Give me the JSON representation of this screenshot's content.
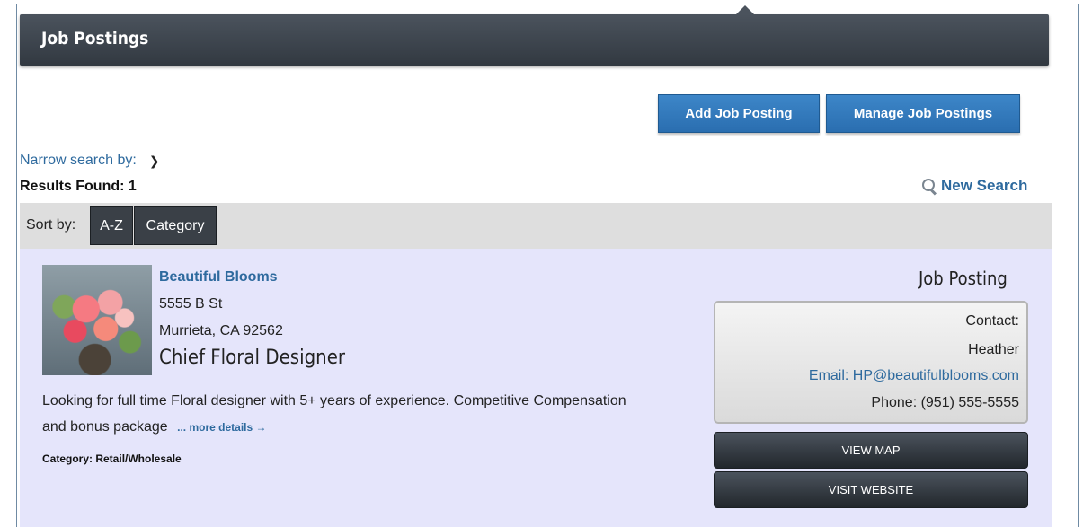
{
  "header": {
    "title": "Job Postings"
  },
  "toolbar": {
    "add_label": "Add Job Posting",
    "manage_label": "Manage Job Postings"
  },
  "filters": {
    "narrow_label": "Narrow search by:",
    "results_label": "Results Found: 1",
    "new_search_label": "New Search"
  },
  "sort": {
    "label": "Sort by:",
    "options": [
      "A-Z",
      "Category"
    ]
  },
  "listing": {
    "business_name": "Beautiful Blooms",
    "address_line1": "5555 B St",
    "address_line2": "Murrieta, CA 92562",
    "job_title": "Chief Floral Designer",
    "description": "Looking for full time Floral designer with 5+ years of experience. Competitive Compensation and bonus package",
    "more_label": "... more details →",
    "category": "Category: Retail/Wholesale",
    "type_label": "Job Posting",
    "contact_label": "Contact:",
    "contact_name": "Heather",
    "email": "Email: HP@beautifulblooms.com",
    "phone": "Phone: (951) 555-5555",
    "view_map_label": "VIEW MAP",
    "visit_website_label": "VISIT WEBSITE"
  },
  "colors": {
    "accent_blue": "#2e6a9e",
    "button_blue": "#3d86c8",
    "header_dark": "#3a4047",
    "listing_bg": "#e5e5fb"
  }
}
